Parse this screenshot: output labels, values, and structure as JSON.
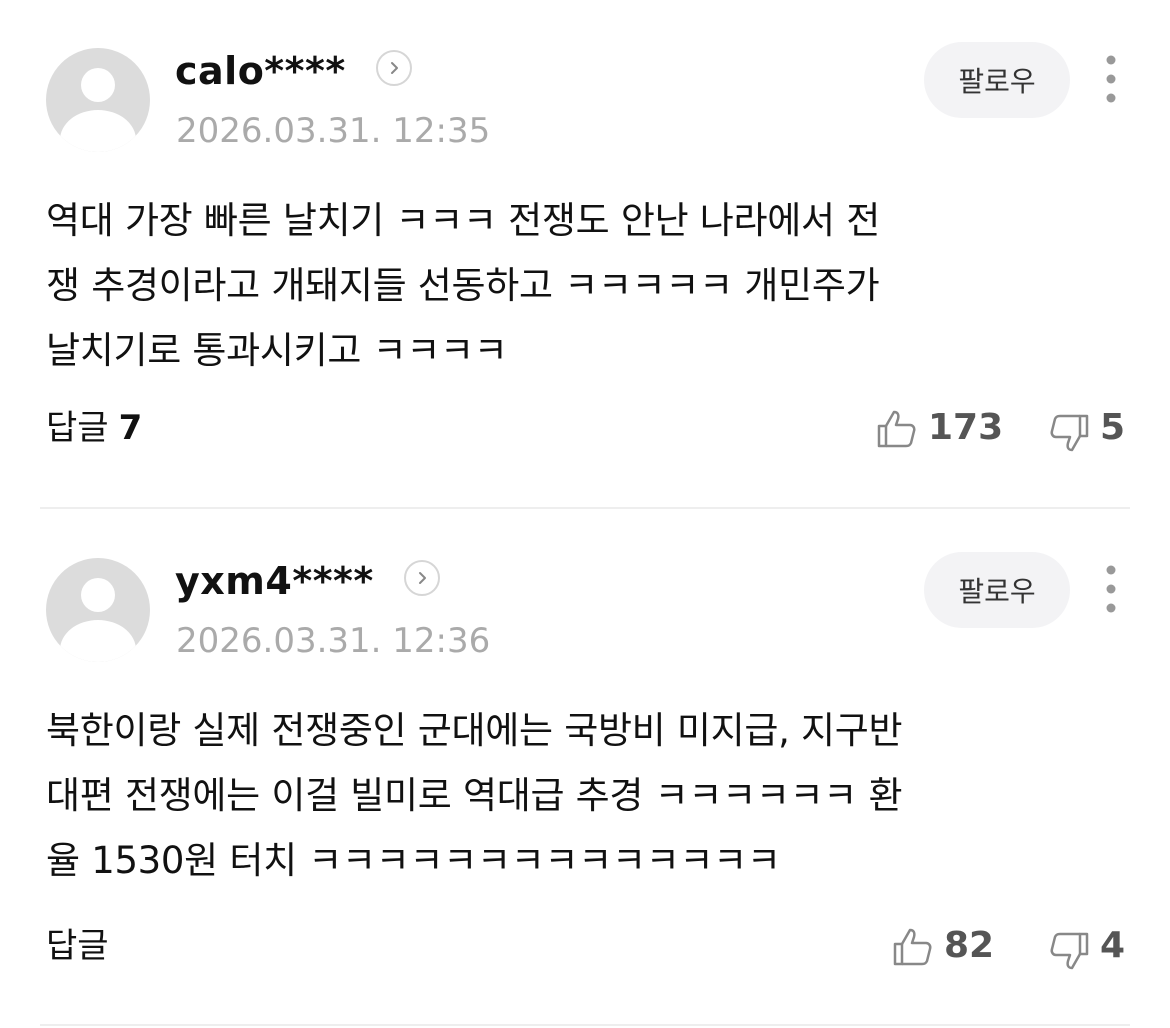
{
  "follow_label": "팔로우",
  "reply_label": "답글",
  "comments": [
    {
      "username": "calo****",
      "timestamp": "2026.03.31. 12:35",
      "text_lines": [
        "역대 가장 빠른 날치기 ㅋㅋㅋ 전쟁도 안난 나라에서 전",
        "쟁 추경이라고 개돼지들 선동하고 ㅋㅋㅋㅋㅋ 개민주가",
        "날치기로 통과시키고 ㅋㅋㅋㅋ"
      ],
      "reply_count": "7",
      "likes": "173",
      "dislikes": "5"
    },
    {
      "username": "yxm4****",
      "timestamp": "2026.03.31. 12:36",
      "text_lines": [
        "북한이랑 실제 전쟁중인 군대에는 국방비 미지급, 지구반",
        "대편 전쟁에는 이걸 빌미로 역대급 추경 ㅋㅋㅋㅋㅋㅋ 환",
        "율 1530원 터치 ㅋㅋㅋㅋㅋㅋㅋㅋㅋㅋㅋㅋㅋㅋ"
      ],
      "reply_count": "",
      "likes": "82",
      "dislikes": "4"
    }
  ],
  "icons": {
    "avatar": "default-user-avatar",
    "profile": "chevron-right-circle-icon",
    "more": "vertical-ellipsis-icon",
    "like": "thumbs-up-outline-icon",
    "dislike": "thumbs-down-outline-icon"
  },
  "colors": {
    "background": "#ffffff",
    "text": "#111111",
    "timestamp": "#aaaaaa",
    "counts": "#555555",
    "follow_bg": "#f3f3f5",
    "avatar_bg": "#dcdcdc",
    "divider": "#eeeeee"
  }
}
